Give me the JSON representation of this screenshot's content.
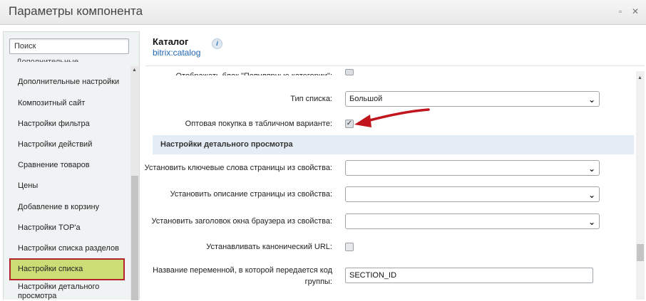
{
  "window": {
    "title": "Параметры компонента",
    "minimize_glyph": "▫",
    "close_glyph": "✕"
  },
  "sidebar": {
    "search_placeholder": "Поиск",
    "top_partial_label": "Дополнительные настройки",
    "items": [
      {
        "label": "Дополнительные настройки"
      },
      {
        "label": "Композитный сайт"
      },
      {
        "label": "Настройки фильтра"
      },
      {
        "label": "Настройки действий"
      },
      {
        "label": "Сравнение товаров"
      },
      {
        "label": "Цены"
      },
      {
        "label": "Добавление в корзину"
      },
      {
        "label": "Настройки TOP'а"
      },
      {
        "label": "Настройки списка разделов"
      },
      {
        "label": "Настройки списка",
        "active": true
      },
      {
        "label": "Настройки детального просмотра"
      }
    ]
  },
  "header": {
    "title": "Каталог",
    "subtitle": "bitrix:catalog",
    "info_glyph": "i"
  },
  "form": {
    "partial_row_label": "Отображать блок \"Популярные категории\":",
    "list_type_label": "Тип списка:",
    "list_type_value": "Большой",
    "wholesale_label": "Оптовая покупка в табличном варианте:",
    "section_title": "Настройки детального просмотра",
    "keywords_label": "Установить ключевые слова страницы из свойства:",
    "keywords_value": "",
    "description_label": "Установить описание страницы из свойства:",
    "description_value": "",
    "browser_title_label": "Установить заголовок окна браузера из свойства:",
    "browser_title_value": "",
    "canonical_label": "Устанавливать канонический URL:",
    "variable_label_line1": "Название переменной, в которой передается код",
    "variable_label_line2": "группы:",
    "variable_value": "SECTION_ID"
  },
  "colors": {
    "active_item_bg": "#cddd76",
    "active_item_border": "#b5232a",
    "arrow": "#c0151c",
    "section_bg": "#e4edf5",
    "link": "#2067b0"
  }
}
